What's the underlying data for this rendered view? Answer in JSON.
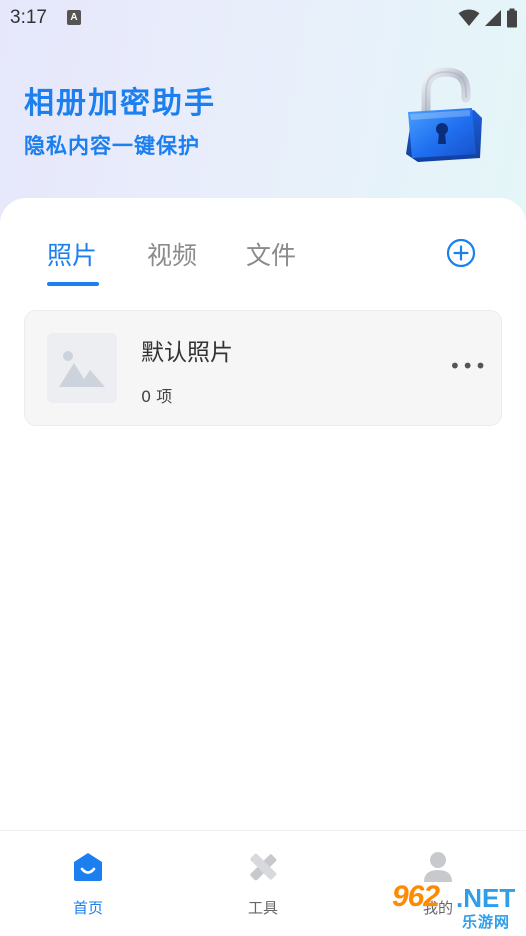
{
  "status_bar": {
    "time": "3:17",
    "keyboard_indicator": "A"
  },
  "hero": {
    "title": "相册加密助手",
    "subtitle": "隐私内容一键保护",
    "illustration": "padlock-icon"
  },
  "tabs": [
    {
      "label": "照片",
      "active": true
    },
    {
      "label": "视频",
      "active": false
    },
    {
      "label": "文件",
      "active": false
    }
  ],
  "add_button_icon": "plus-circle-icon",
  "albums": [
    {
      "name": "默认照片",
      "count": "0 项",
      "thumbnail_icon": "image-placeholder-icon",
      "menu_icon": "more-icon"
    }
  ],
  "bottom_nav": [
    {
      "label": "首页",
      "icon": "home-icon",
      "active": true
    },
    {
      "label": "工具",
      "icon": "tools-icon",
      "active": false
    },
    {
      "label": "我的",
      "icon": "user-icon",
      "active": false
    }
  ],
  "watermark": {
    "number": "962",
    "domain": ".NET",
    "cn": "乐游网"
  },
  "colors": {
    "accent": "#1b7ff0",
    "inactive_tab": "#8b8b8b",
    "card_bg": "#f6f6f7"
  }
}
